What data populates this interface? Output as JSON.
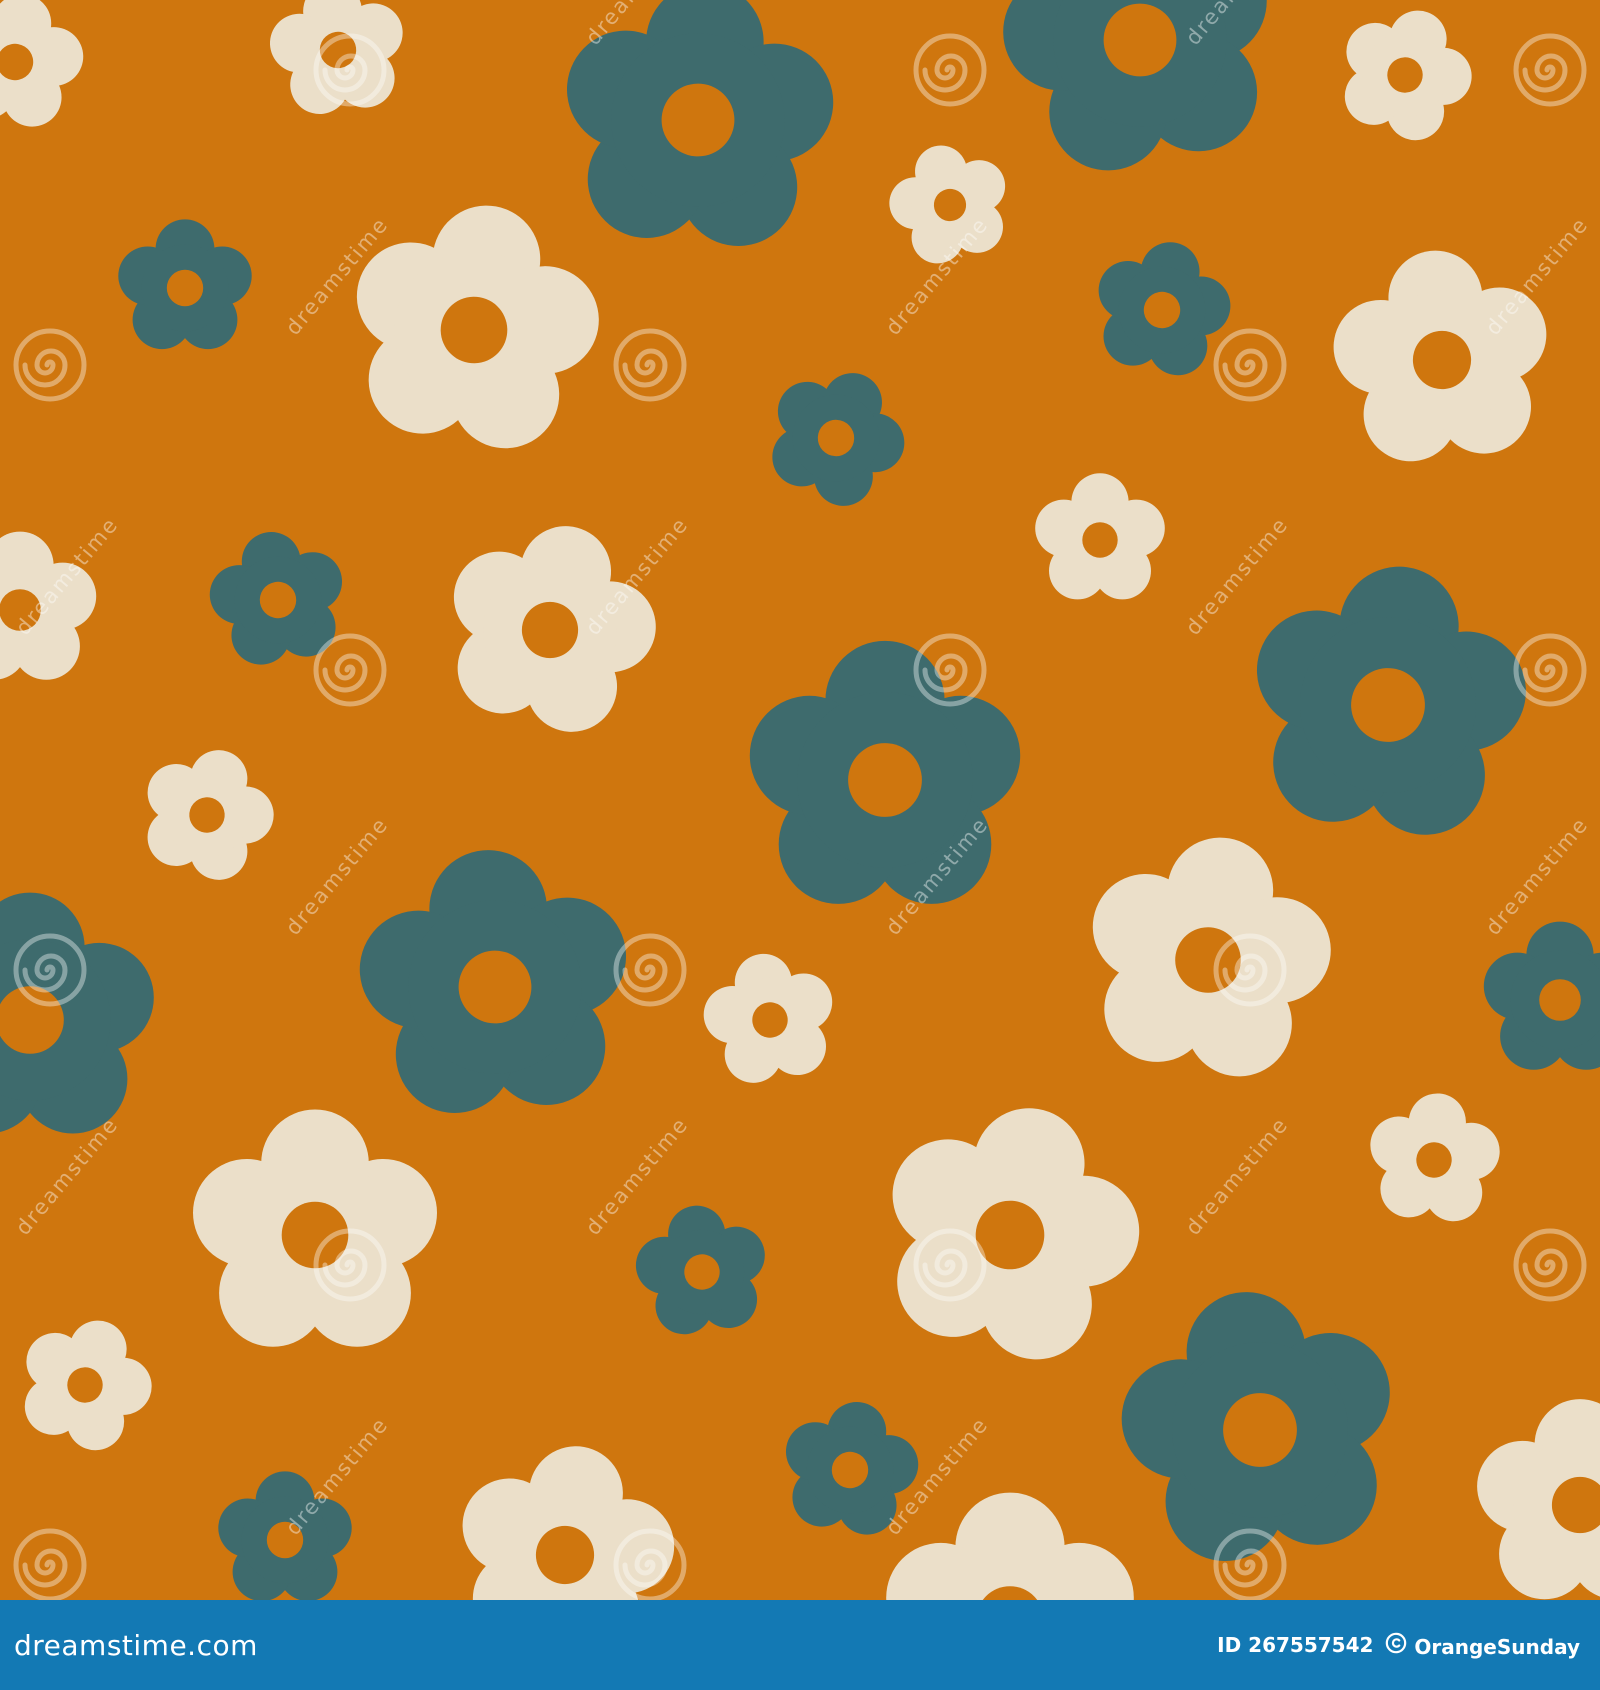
{
  "colors": {
    "background": "#cf760e",
    "teal": "#3e6b6d",
    "cream": "#ebdfc9",
    "bar": "#1379b4",
    "watermark": "#ffffff"
  },
  "watermark": {
    "text": "dreamstime",
    "icon": "swirl-icon"
  },
  "credit": {
    "site": "dreamstime.com",
    "id_label": "ID 267557542",
    "author": "OrangeSunday",
    "author_icon": "copyright-icon"
  }
}
